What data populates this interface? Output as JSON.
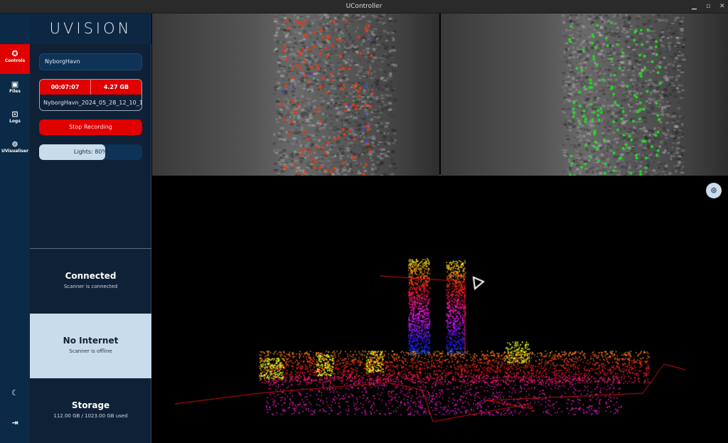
{
  "window": {
    "title": "UController",
    "controls": [
      "minimize",
      "maximize",
      "close"
    ]
  },
  "nav": {
    "items": [
      {
        "label": "Controls",
        "icon": "aperture-icon",
        "active": true
      },
      {
        "label": "Files",
        "icon": "images-icon",
        "active": false
      },
      {
        "label": "Logs",
        "icon": "terminal-icon",
        "active": false
      },
      {
        "label": "UVisualiser",
        "icon": "cube-focus-icon",
        "active": false
      }
    ],
    "bottom": [
      {
        "icon": "moon-icon"
      },
      {
        "icon": "logout-icon"
      }
    ]
  },
  "panel": {
    "logo": "UVISION",
    "site_name": "NyborgHavn",
    "recording": {
      "elapsed": "00:07:07",
      "size": "4.27 GB",
      "filename": "NyborgHavn_2024_05_28_12_10_1"
    },
    "stop_label": "Stop Recording",
    "lights": {
      "label": "Lights: 80%",
      "percent": 80
    },
    "status": [
      {
        "title": "Connected",
        "subtitle": "Scanner is connected"
      },
      {
        "title": "No Internet",
        "subtitle": "Scanner is offline"
      },
      {
        "title": "Storage",
        "subtitle": "112.00 GB / 1023.00 GB used"
      }
    ]
  },
  "viewer": {
    "button_icon": "recenter-icon"
  },
  "colors": {
    "accent": "#e00000",
    "rail": "#0a2a47",
    "panel": "#0e2137",
    "light": "#c9dcec",
    "features_left": "#e83a10",
    "features_right": "#22dd22",
    "trajectory": "#d01010"
  }
}
